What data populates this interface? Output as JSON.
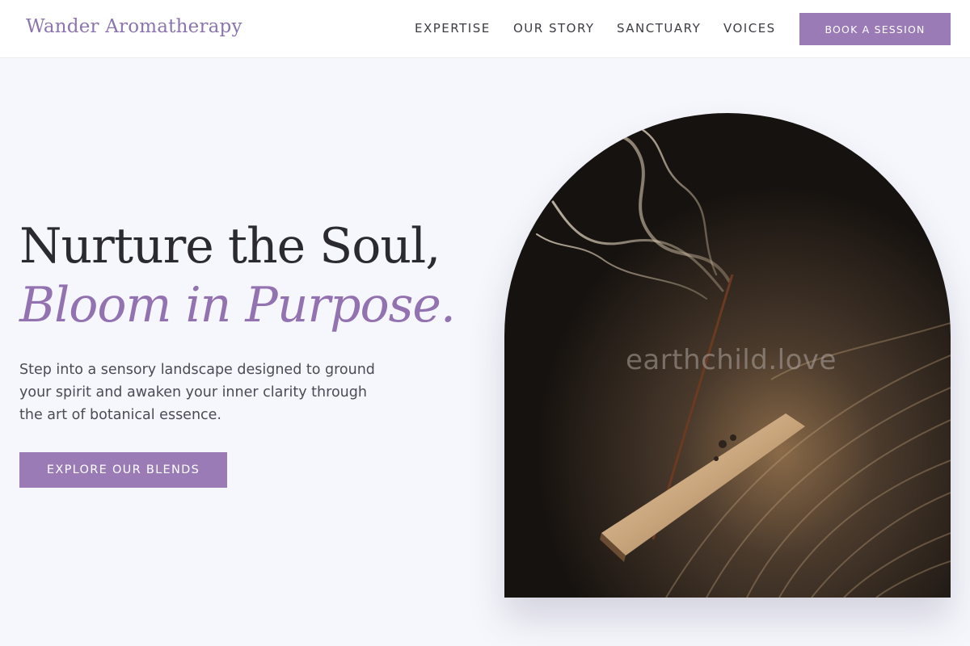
{
  "brand": {
    "name": "Wander Aromatherapy"
  },
  "nav": {
    "items": [
      "EXPERTISE",
      "OUR STORY",
      "SANCTUARY",
      "VOICES"
    ],
    "cta_label": "BOOK A SESSION"
  },
  "hero": {
    "headline_line1": "Nurture the Soul,",
    "headline_line2": "Bloom in Purpose.",
    "body": "Step into a sensory landscape designed to ground your spirit and awaken your inner clarity through the art of botanical essence.",
    "cta_label": "EXPLORE OUR BLENDS",
    "image_watermark": "earthchild.love"
  },
  "colors": {
    "accent": "#9a7bb6",
    "accent_text": "#9272b0",
    "brand": "#8c75ae",
    "background": "#f6f7fc",
    "header_bg": "#ffffff",
    "dark_text": "#2a2a30"
  }
}
